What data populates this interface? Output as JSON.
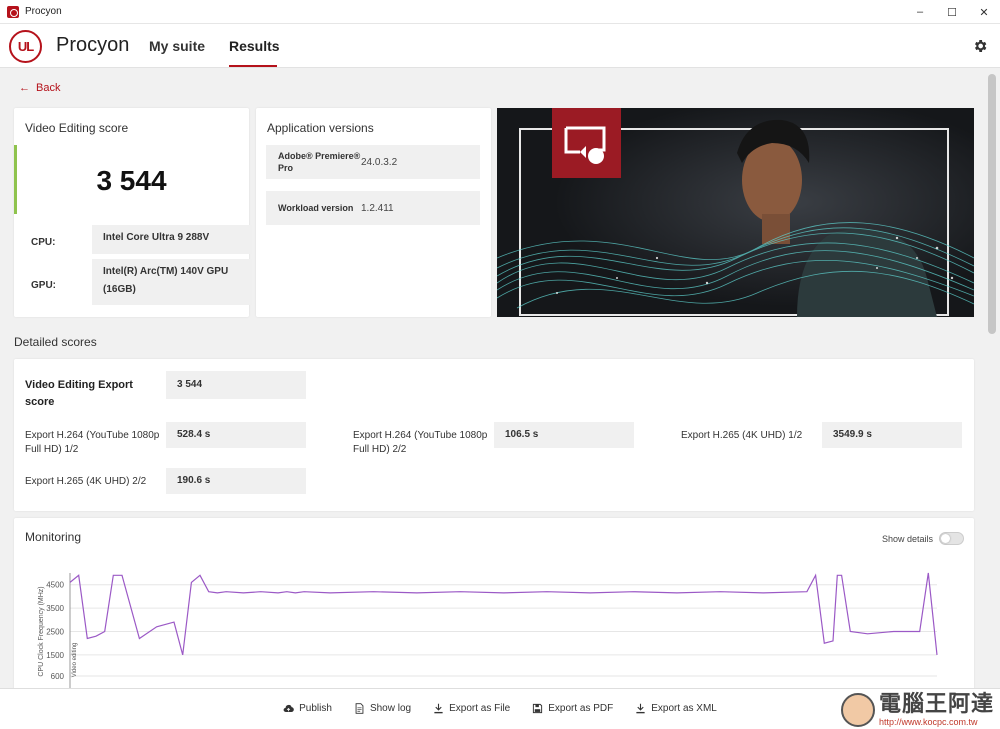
{
  "window": {
    "title": "Procyon",
    "controls": {
      "minimize": "–",
      "maximize": "☐",
      "close": "✕"
    }
  },
  "header": {
    "logo_text": "UL",
    "brand": "Procyon",
    "tabs": [
      {
        "label": "My suite"
      },
      {
        "label": "Results"
      }
    ],
    "active_tab": "Results",
    "accent_color": "#b5121b"
  },
  "back_label": "Back",
  "score_card": {
    "title": "Video Editing score",
    "score": "3 544",
    "cpu_label": "CPU:",
    "cpu_value": "Intel Core Ultra 9 288V",
    "gpu_label": "GPU:",
    "gpu_value": "Intel(R) Arc(TM) 140V GPU (16GB)",
    "bar_color": "#8fc34d"
  },
  "versions_card": {
    "title": "Application versions",
    "rows": [
      {
        "name": "Adobe® Premiere® Pro",
        "value": "24.0.3.2"
      },
      {
        "name": "Workload version",
        "value": "1.2.411"
      }
    ]
  },
  "detailed": {
    "section_title": "Detailed scores",
    "main": {
      "label": "Video Editing Export score",
      "value": "3 544"
    },
    "items": [
      {
        "label": "Export H.264 (YouTube 1080p Full HD) 1/2",
        "value": "528.4 s"
      },
      {
        "label": "Export H.264 (YouTube 1080p Full HD) 2/2",
        "value": "106.5 s"
      },
      {
        "label": "Export H.265 (4K UHD) 1/2",
        "value": "3549.9 s"
      },
      {
        "label": "Export H.265 (4K UHD) 2/2",
        "value": "190.6 s"
      }
    ]
  },
  "monitoring": {
    "title": "Monitoring",
    "show_details_label": "Show details",
    "show_details_on": false
  },
  "chart_data": {
    "type": "line",
    "ylabel": "CPU Clock Frequency (MHz)",
    "marker_label": "Video editing",
    "yticks": [
      600,
      1500,
      2500,
      3500,
      4500
    ],
    "ylim": [
      0,
      5000
    ],
    "line_color": "#9b59c6",
    "series": [
      {
        "x": [
          0,
          1,
          2,
          3,
          4,
          5,
          6,
          8,
          10,
          12,
          13,
          14,
          15,
          16,
          17,
          18,
          20,
          22,
          24,
          25,
          26,
          27,
          30,
          35,
          40,
          45,
          50,
          55,
          60,
          65,
          70,
          75,
          80,
          85,
          86,
          87,
          88,
          88.5,
          89,
          90,
          92,
          95,
          98,
          99,
          100
        ],
        "y": [
          4600,
          4900,
          2200,
          2300,
          2500,
          4900,
          4900,
          2200,
          2700,
          2900,
          1500,
          4600,
          4900,
          4200,
          4150,
          4200,
          4150,
          4200,
          4150,
          4200,
          4150,
          4200,
          4150,
          4200,
          4150,
          4200,
          4150,
          4200,
          4150,
          4200,
          4150,
          4200,
          4150,
          4200,
          4900,
          2000,
          2100,
          4900,
          4900,
          2500,
          2400,
          2500,
          2500,
          5000,
          1500
        ]
      }
    ]
  },
  "footer": {
    "actions": [
      {
        "label": "Publish",
        "icon": "cloud-upload-icon"
      },
      {
        "label": "Show log",
        "icon": "document-icon"
      },
      {
        "label": "Export as File",
        "icon": "download-icon"
      },
      {
        "label": "Export as PDF",
        "icon": "save-icon"
      },
      {
        "label": "Export as XML",
        "icon": "download-icon"
      }
    ],
    "watermark_text": "電腦王阿達",
    "watermark_url": "http://www.kocpc.com.tw"
  }
}
